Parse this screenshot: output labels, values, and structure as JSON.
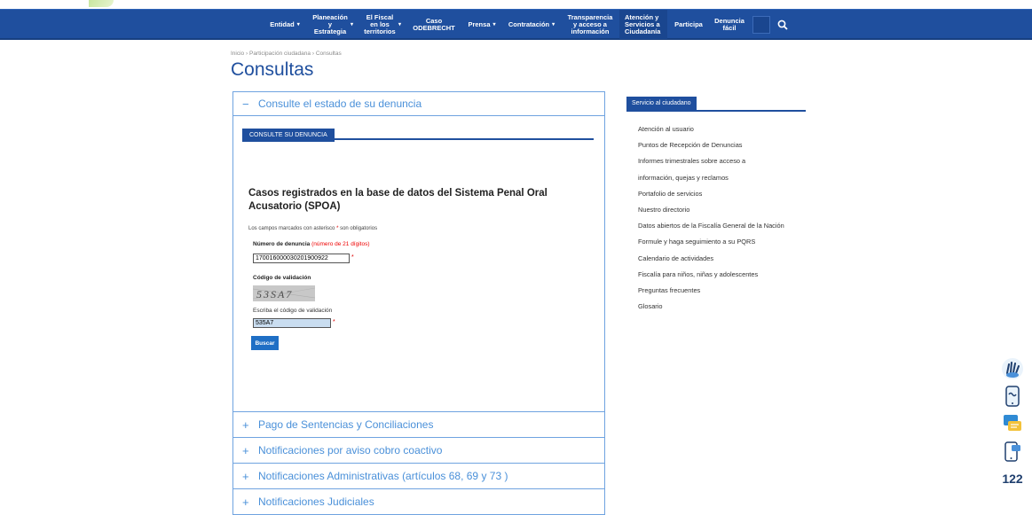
{
  "colors": {
    "brand_blue": "#1f4f9e",
    "accordion_border": "#6fa3e0",
    "accent_light_blue": "#4a90d9",
    "required_red": "#dd0000"
  },
  "nav": {
    "items": [
      {
        "label": "Entidad",
        "caret": "▾"
      },
      {
        "label": "Planeación y Estrategia",
        "caret": "▾"
      },
      {
        "label": "El Fiscal en los territorios",
        "caret": "▾"
      },
      {
        "label": "Caso ODEBRECHT",
        "caret": ""
      },
      {
        "label": "Prensa",
        "caret": "▾"
      },
      {
        "label": "Contratación",
        "caret": "▾"
      },
      {
        "label": "Transparencia y acceso a información",
        "caret": ""
      },
      {
        "label": "Atención y Servicios a Ciudadanía",
        "caret": ""
      },
      {
        "label": "Participa",
        "caret": ""
      },
      {
        "label": "Denuncia fácil",
        "caret": ""
      }
    ],
    "search_icon": "search-icon"
  },
  "breadcrumb": {
    "home": "Inicio",
    "sep1": "›",
    "section": "Participación ciudadana",
    "sep2": "›",
    "current": "Consultas"
  },
  "page_title": "Consultas",
  "accordion": {
    "open_panel": {
      "sign": "−",
      "title": "Consulte el estado de su denuncia",
      "tab_label": "CONSULTE SU DENUNCIA",
      "form_title": "Casos registrados en la base de datos del Sistema Penal Oral Acusatorio (SPOA)",
      "required_note_prefix": "Los campos marcados con asterisco",
      "required_note_asterisk": "*",
      "required_note_suffix": "son obligatorios",
      "numero_label": "Número de denuncia",
      "numero_hint": "(número de 21 dígitos)",
      "numero_value": "170016000030201900922",
      "asterisk": "*",
      "codigo_label": "Código de validación",
      "captcha_text": "53SA7",
      "write_label": "Escriba el código de validación",
      "codigo_value": "535A7",
      "buscar_label": "Buscar"
    },
    "collapsed_panels": [
      {
        "sign": "+",
        "title": "Pago de Sentencias y Conciliaciones"
      },
      {
        "sign": "+",
        "title": "Notificaciones por aviso cobro coactivo"
      },
      {
        "sign": "+",
        "title": "Notificaciones Administrativas (artículos 68, 69 y 73 )"
      },
      {
        "sign": "+",
        "title": "Notificaciones Judiciales"
      }
    ]
  },
  "sidebar": {
    "title": "Servicio al ciudadano",
    "items": [
      "Atención al usuario",
      "Puntos de Recepción de Denuncias",
      "Informes trimestrales sobre acceso a",
      "información, quejas y reclamos",
      "Portafolio de servicios",
      "Nuestro directorio",
      "Datos abiertos de la Fiscalía General de la Nación",
      "Formule y haga seguimiento a su PQRS",
      "Calendario de actividades",
      "Fiscalía para niños, niñas y adolescentes",
      "Preguntas frecuentes",
      "Glosario"
    ]
  },
  "floating": {
    "icons": [
      "sign-language-icon",
      "phone-icon",
      "chat-icon",
      "mobile-chat-icon"
    ],
    "number": "122"
  }
}
